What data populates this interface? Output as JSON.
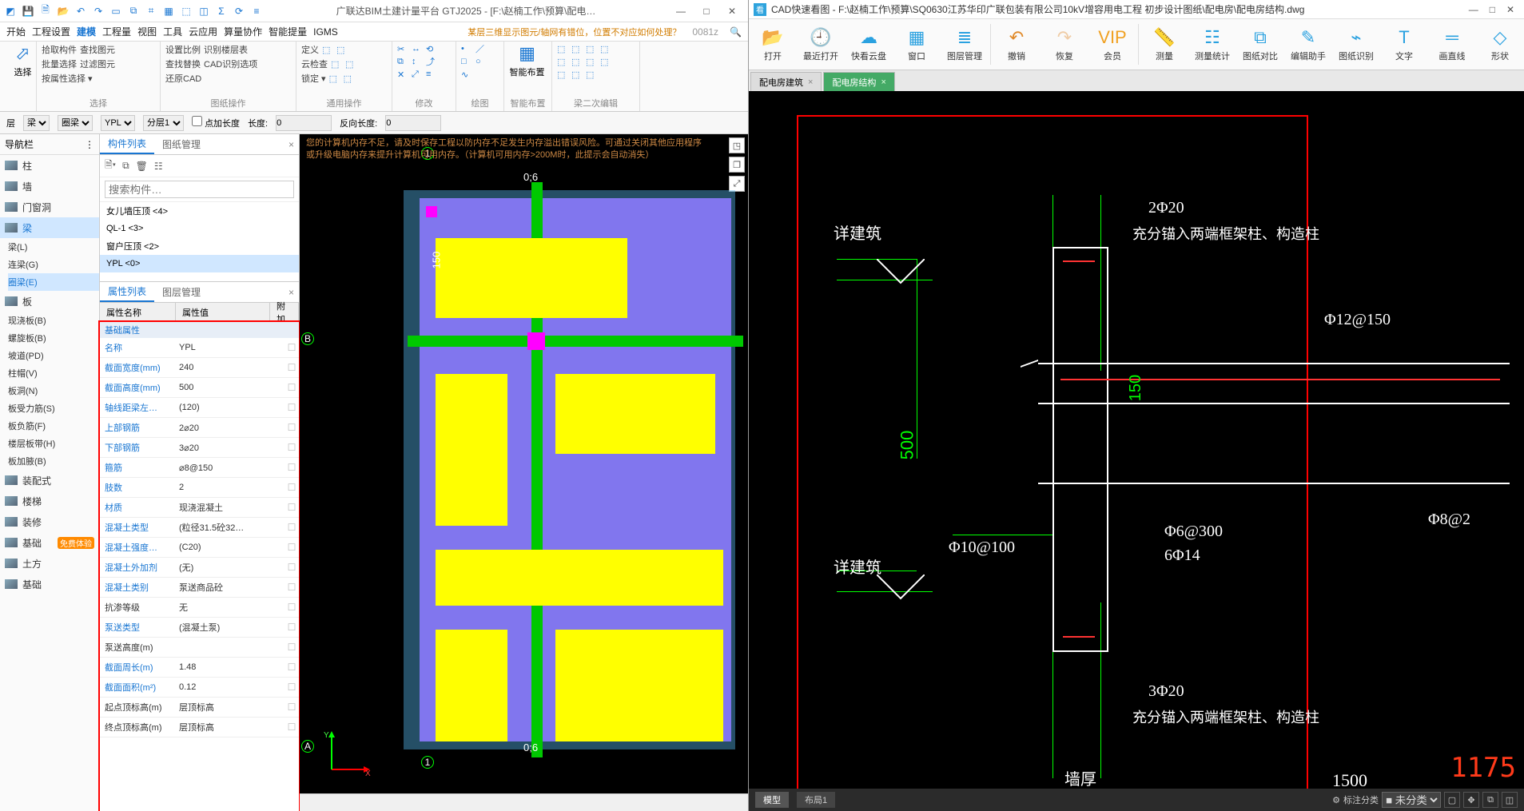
{
  "gtj": {
    "title": "广联达BIM土建计量平台 GTJ2025 - [F:\\赵楠工作\\预算\\配电…",
    "menu": [
      "开始",
      "工程设置",
      "建模",
      "工程量",
      "视图",
      "工具",
      "云应用",
      "算量协作",
      "智能提量",
      "IGMS"
    ],
    "menu_active_index": 2,
    "hint_question": "某层三维显示图元/轴网有错位，位置不对应如何处理？",
    "search_code": "0081z",
    "ribbon": {
      "g_select": {
        "label": "选择",
        "big": "选择",
        "r1": [
          "拾取构件",
          "查找图元"
        ],
        "r2": [
          "批量选择",
          "过滤图元"
        ],
        "r3": [
          "按属性选择 ▾"
        ]
      },
      "g_cad": {
        "label": "图纸操作",
        "r1": [
          "设置比例",
          "识别楼层表"
        ],
        "r2": [
          "查找替换",
          "CAD识别选项"
        ],
        "r3": [
          "还原CAD"
        ]
      },
      "g_common": {
        "label": "通用操作",
        "r1": [
          "定义",
          "云检查",
          "锁定 ▾"
        ]
      },
      "g_modify": {
        "label": "修改"
      },
      "g_draw": {
        "label": "绘图"
      },
      "g_smart": {
        "label": "智能布置",
        "big": "智能布置"
      },
      "g_edit2": {
        "label": "梁二次编辑"
      }
    },
    "filter": {
      "layer": "层",
      "cat": "梁",
      "type": "圈梁",
      "name": "YPL",
      "level": "分层1",
      "dot_len": "点加长度",
      "len_label": "长度:",
      "rev_len_label": "反向长度:",
      "len": "0",
      "rev": "0"
    },
    "navbar_title": "导航栏",
    "nav_groups": [
      {
        "icon": "柱",
        "label": "柱"
      },
      {
        "icon": "墙",
        "label": "墙"
      },
      {
        "icon": "门",
        "label": "门窗洞"
      },
      {
        "icon": "梁",
        "label": "梁",
        "selected": true,
        "subs": [
          {
            "label": "梁(L)"
          },
          {
            "label": "连梁(G)"
          },
          {
            "label": "圈梁(E)",
            "selected": true
          }
        ]
      },
      {
        "icon": "板",
        "label": "板",
        "subs": [
          {
            "label": "现浇板(B)"
          },
          {
            "label": "螺旋板(B)"
          },
          {
            "label": "坡道(PD)"
          },
          {
            "label": "柱帽(V)"
          },
          {
            "label": "板洞(N)"
          },
          {
            "label": "板受力筋(S)"
          },
          {
            "label": "板负筋(F)"
          },
          {
            "label": "楼层板带(H)"
          },
          {
            "label": "板加腋(B)"
          }
        ]
      },
      {
        "icon": "装",
        "label": "装配式"
      },
      {
        "icon": "楼",
        "label": "楼梯"
      },
      {
        "icon": "修",
        "label": "装修"
      },
      {
        "icon": "基",
        "label": "基础",
        "badge": "免费体验"
      },
      {
        "icon": "土",
        "label": "土方"
      },
      {
        "icon": "础",
        "label": "基础"
      }
    ],
    "mid": {
      "tabs_top": [
        "构件列表",
        "图纸管理"
      ],
      "search_ph": "搜索构件…",
      "components": [
        {
          "label": "女儿墙压顶 <4>"
        },
        {
          "label": "QL-1 <3>"
        },
        {
          "label": "窗户压顶 <2>"
        },
        {
          "label": "YPL <0>",
          "selected": true
        }
      ],
      "tabs_bot": [
        "属性列表",
        "图层管理"
      ],
      "prop_cols": [
        "属性名称",
        "属性值",
        "附加"
      ],
      "prop_section": "基础属性",
      "props": [
        {
          "n": "名称",
          "v": "YPL",
          "blue": true
        },
        {
          "n": "截面宽度(mm)",
          "v": "240",
          "blue": true
        },
        {
          "n": "截面高度(mm)",
          "v": "500",
          "blue": true
        },
        {
          "n": "轴线距梁左…",
          "v": "(120)",
          "blue": true
        },
        {
          "n": "上部钢筋",
          "v": "2⌀20",
          "blue": true
        },
        {
          "n": "下部钢筋",
          "v": "3⌀20",
          "blue": true
        },
        {
          "n": "箍筋",
          "v": "⌀8@150",
          "blue": true
        },
        {
          "n": "肢数",
          "v": "2",
          "blue": true
        },
        {
          "n": "材质",
          "v": "现浇混凝土",
          "blue": true
        },
        {
          "n": "混凝土类型",
          "v": "(粒径31.5砼32…",
          "blue": true
        },
        {
          "n": "混凝土强度…",
          "v": "(C20)",
          "blue": true
        },
        {
          "n": "混凝土外加剂",
          "v": "(无)",
          "blue": true
        },
        {
          "n": "混凝土类别",
          "v": "泵送商品砼",
          "blue": true
        },
        {
          "n": "抗渗等级",
          "v": "无"
        },
        {
          "n": "泵送类型",
          "v": "(混凝土泵)",
          "blue": true
        },
        {
          "n": "泵送高度(m)",
          "v": ""
        },
        {
          "n": "截面周长(m)",
          "v": "1.48",
          "blue": true
        },
        {
          "n": "截面面积(m²)",
          "v": "0.12",
          "blue": true
        },
        {
          "n": "起点顶标高(m)",
          "v": "层顶标高"
        },
        {
          "n": "终点顶标高(m)",
          "v": "层顶标高"
        }
      ]
    },
    "canvas_hint": "您的计算机内存不足，请及时保存工程以防内存不足发生内存溢出错误风险。可通过关闭其他应用程序或升级电脑内存来提升计算机可用内存。（计算机可用内存>200M时，此提示会自动消失）",
    "dims": {
      "top": "0;6",
      "bot": "0;6",
      "left_num": "150"
    },
    "grid": {
      "A": "A",
      "B": "B",
      "one": "1"
    }
  },
  "cad": {
    "title": "CAD快速看图 - F:\\赵楠工作\\预算\\SQ0630江苏华印广联包装有限公司10kV增容用电工程 初步设计图纸\\配电房\\配电房结构.dwg",
    "ribbon": [
      {
        "icon": "📂",
        "label": "打开",
        "c": "#2aa1e0"
      },
      {
        "icon": "🕘",
        "label": "最近打开",
        "c": "#2aa1e0"
      },
      {
        "icon": "☁",
        "label": "快看云盘",
        "c": "#2aa1e0"
      },
      {
        "icon": "▦",
        "label": "窗口",
        "c": "#2aa1e0"
      },
      {
        "icon": "≣",
        "label": "图层管理",
        "c": "#2aa1e0"
      },
      {
        "sep": true
      },
      {
        "icon": "↶",
        "label": "撤销",
        "c": "#e08a2a"
      },
      {
        "icon": "↷",
        "label": "恢复",
        "c": "#e08a2a",
        "dim": true
      },
      {
        "icon": "VIP",
        "label": "会员",
        "c": "#f0a020"
      },
      {
        "sep": true
      },
      {
        "icon": "📏",
        "label": "测量",
        "c": "#2aa1e0"
      },
      {
        "icon": "☷",
        "label": "测量统计",
        "c": "#2aa1e0"
      },
      {
        "icon": "⧉",
        "label": "图纸对比",
        "c": "#2aa1e0"
      },
      {
        "icon": "✎",
        "label": "编辑助手",
        "c": "#2aa1e0"
      },
      {
        "icon": "⌁",
        "label": "图纸识别",
        "c": "#2aa1e0"
      },
      {
        "icon": "T",
        "label": "文字",
        "c": "#2aa1e0"
      },
      {
        "icon": "═",
        "label": "画直线",
        "c": "#2aa1e0"
      },
      {
        "icon": "◇",
        "label": "形状",
        "c": "#2aa1e0"
      }
    ],
    "tabs": [
      {
        "label": "配电房建筑"
      },
      {
        "label": "配电房结构",
        "active": true
      }
    ],
    "texts": {
      "t1": "2Φ20",
      "t2": "充分锚入两端框架柱、构造柱",
      "t3": "Φ12@150",
      "t4": "详建筑",
      "t5": "详建筑",
      "t6": "Φ10@100",
      "t7": "Φ6@300",
      "t8": "6Φ14",
      "t9": "3Φ20",
      "t10": "充分锚入两端框架柱、构造柱",
      "t11": "墙厚",
      "t12": "1500",
      "t13": "Φ8@2",
      "d500": "500",
      "d150": "150"
    },
    "status": {
      "tabs": [
        "模型",
        "布局1"
      ],
      "tag_label": "标注分类",
      "tag_value": "未分类",
      "big_num": "1175"
    }
  }
}
